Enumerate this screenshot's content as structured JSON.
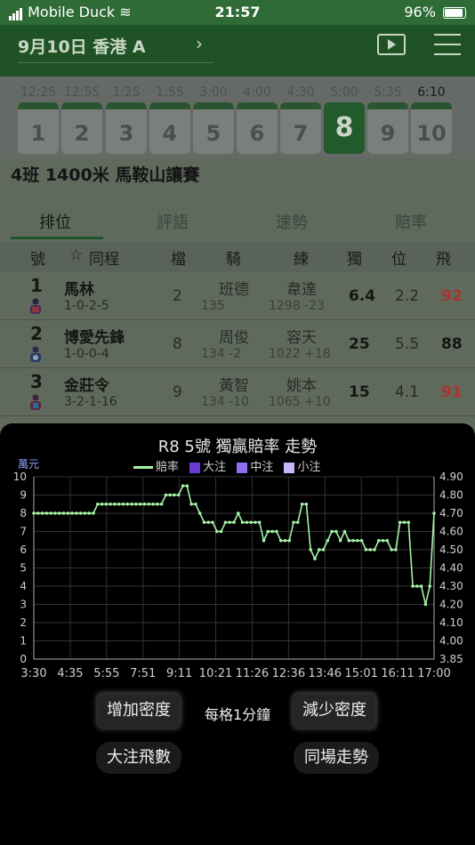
{
  "status": {
    "carrier": "Mobile Duck",
    "time": "21:57",
    "battery": "96%"
  },
  "header": {
    "title": "9月10日 香港 A",
    "chevron": "›",
    "tv_icon": "tv-icon",
    "menu_icon": "menu-icon"
  },
  "races": [
    {
      "time": "12:25",
      "num": "1"
    },
    {
      "time": "12:55",
      "num": "2"
    },
    {
      "time": "1:25",
      "num": "3"
    },
    {
      "time": "1:55",
      "num": "4"
    },
    {
      "time": "3:00",
      "num": "5"
    },
    {
      "time": "4:00",
      "num": "6"
    },
    {
      "time": "4:30",
      "num": "7"
    },
    {
      "time": "5:00",
      "num": "8"
    },
    {
      "time": "5:35",
      "num": "9"
    },
    {
      "time": "6:10",
      "num": "10"
    }
  ],
  "race_name": "4班 1400米 馬鞍山讓賽",
  "tabs": [
    "排位",
    "評語",
    "速勢",
    "賠率"
  ],
  "table": {
    "headers": {
      "no": "號",
      "star": "☆",
      "horse": "同程",
      "draw": "檔",
      "jockey": "騎",
      "trainer": "練",
      "win": "獨",
      "place": "位",
      "fly": "飛"
    },
    "rows": [
      {
        "no": "1",
        "horse": "馬林",
        "form": "1-0-2-5",
        "draw": "2",
        "jockey": "班德",
        "jockey_detail": "135",
        "trainer": "韋達",
        "trainer_detail": "1298 -23",
        "win": "6.4",
        "place": "2.2",
        "fly": "92",
        "fly_color": "#a8362e"
      },
      {
        "no": "2",
        "horse": "博愛先鋒",
        "form": "1-0-0-4",
        "draw": "8",
        "jockey": "周俊",
        "jockey_detail": "134 -2",
        "trainer": "容天",
        "trainer_detail": "1022 +18",
        "win": "25",
        "place": "5.5",
        "fly": "88",
        "fly_color": "#141414"
      },
      {
        "no": "3",
        "horse": "金莊令",
        "form": "3-2-1-16",
        "draw": "9",
        "jockey": "黃智",
        "jockey_detail": "134 -10",
        "trainer": "姚本",
        "trainer_detail": "1065 +10",
        "win": "15",
        "place": "4.1",
        "fly": "91",
        "fly_color": "#a8362e"
      }
    ]
  },
  "popup": {
    "title": "R8 5號 獨贏賠率 走勢",
    "unit_label": "萬元",
    "legend": [
      {
        "label": "賠率",
        "color": "#a6f3a6",
        "kind": "line"
      },
      {
        "label": "大注",
        "color": "#6a3ad6",
        "kind": "square"
      },
      {
        "label": "中注",
        "color": "#8f6cf0",
        "kind": "square"
      },
      {
        "label": "小注",
        "color": "#c7b6f7",
        "kind": "square"
      }
    ],
    "buttons": {
      "increase": "增加密度",
      "per_step": "每格1分鐘",
      "decrease": "減少密度",
      "big_bet": "大注飛數",
      "same_field": "同場走勢"
    }
  },
  "chart_data": {
    "type": "line",
    "title": "R8 5號 獨贏賠率 走勢",
    "x_tick_labels": [
      "3:30",
      "4:35",
      "5:55",
      "7:51",
      "9:11",
      "10:21",
      "11:26",
      "12:36",
      "13:46",
      "15:01",
      "16:11",
      "17:00"
    ],
    "left_axis": {
      "label": "萬元",
      "ylim": [
        0,
        10
      ],
      "ticks": [
        0,
        1,
        2,
        3,
        4,
        5,
        6,
        7,
        8,
        9,
        10
      ]
    },
    "right_axis": {
      "ylim": [
        3.85,
        4.9
      ],
      "ticks": [
        3.85,
        4.0,
        4.1,
        4.2,
        4.3,
        4.4,
        4.5,
        4.6,
        4.7,
        4.8,
        4.9
      ]
    },
    "grid": true,
    "legend_position": "top",
    "series": [
      {
        "name": "賠率",
        "axis": "right",
        "values": [
          4.7,
          4.7,
          4.7,
          4.7,
          4.7,
          4.7,
          4.7,
          4.7,
          4.7,
          4.7,
          4.7,
          4.7,
          4.7,
          4.7,
          4.7,
          4.75,
          4.75,
          4.75,
          4.75,
          4.75,
          4.75,
          4.75,
          4.75,
          4.75,
          4.75,
          4.75,
          4.75,
          4.75,
          4.75,
          4.75,
          4.75,
          4.8,
          4.8,
          4.8,
          4.8,
          4.85,
          4.85,
          4.75,
          4.75,
          4.7,
          4.65,
          4.65,
          4.65,
          4.6,
          4.6,
          4.65,
          4.65,
          4.65,
          4.7,
          4.65,
          4.65,
          4.65,
          4.65,
          4.65,
          4.55,
          4.6,
          4.6,
          4.6,
          4.55,
          4.55,
          4.55,
          4.65,
          4.65,
          4.75,
          4.75,
          4.5,
          4.45,
          4.5,
          4.5,
          4.55,
          4.6,
          4.6,
          4.55,
          4.6,
          4.55,
          4.55,
          4.55,
          4.55,
          4.5,
          4.5,
          4.5,
          4.55,
          4.55,
          4.55,
          4.5,
          4.5,
          4.65,
          4.65,
          4.65,
          4.3,
          4.3,
          4.3,
          4.2,
          4.3,
          4.7
        ]
      },
      {
        "name": "大注",
        "axis": "left",
        "values": []
      },
      {
        "name": "中注",
        "axis": "left",
        "values": []
      },
      {
        "name": "小注",
        "axis": "left",
        "values": []
      }
    ]
  }
}
